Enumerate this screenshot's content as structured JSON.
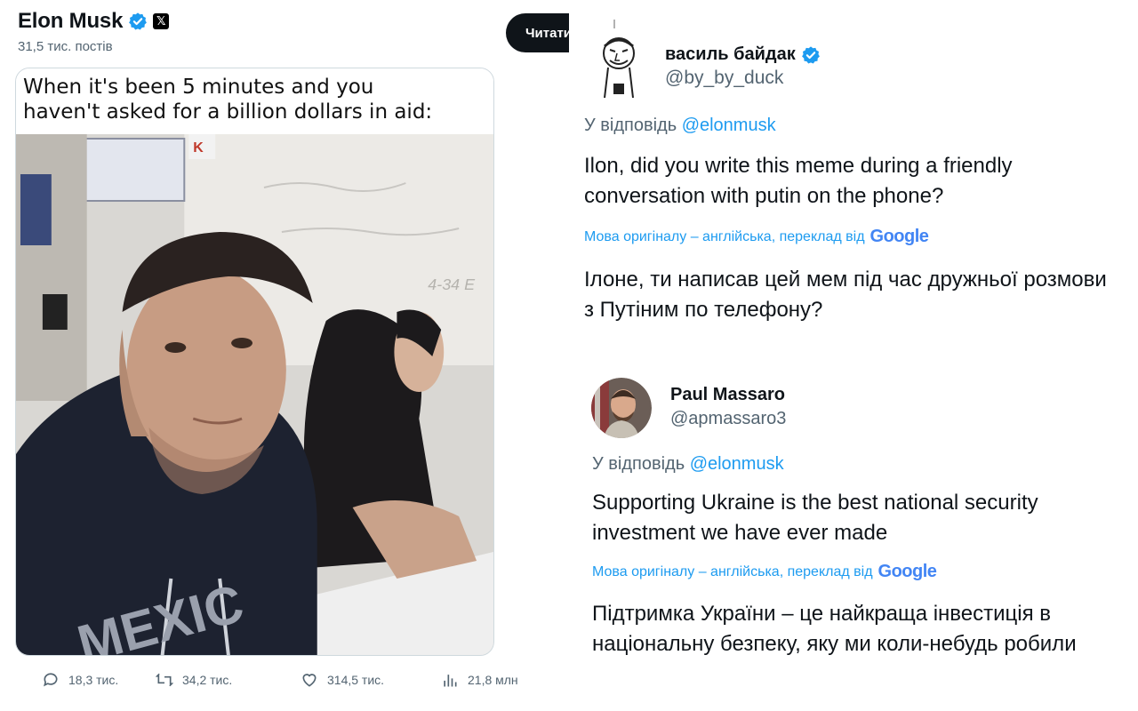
{
  "left_post": {
    "author_name": "Elon Musk",
    "posts_count": "31,5 тис. постів",
    "follow_label": "Читати",
    "meme_caption_line1": "When it's been 5 minutes and you",
    "meme_caption_line2": "haven't asked for a billion dollars in aid:",
    "stats": {
      "replies": "18,3 тис.",
      "reposts": "34,2 тис.",
      "likes": "314,5 тис.",
      "views": "21,8 млн"
    }
  },
  "reply1": {
    "author_name": "василь байдак",
    "handle": "@by_by_duck",
    "reply_prefix": "У відповідь",
    "reply_to": "@elonmusk",
    "text_line1": "Ilon, did you write this meme during a friendly",
    "text_line2": "conversation with putin on the phone?",
    "translation_note": "Мова оригіналу – англійська, переклад від",
    "translation_provider": "Google",
    "translation_line1": "Ілоне, ти написав цей мем під час дружньої розмови",
    "translation_line2": "з Путіним по телефону?"
  },
  "reply2": {
    "author_name": "Paul Massaro",
    "handle": "@apmassaro3",
    "reply_prefix": "У відповідь",
    "reply_to": "@elonmusk",
    "text_line1": "Supporting Ukraine is the best national security",
    "text_line2": "investment we have ever made",
    "translation_note": "Мова оригіналу – англійська, переклад від",
    "translation_provider": "Google",
    "translation_line1": "Підтримка України – це найкраща інвестиція в",
    "translation_line2": "національну безпеку, яку ми коли-небудь робили"
  },
  "colors": {
    "accent": "#1d9bf0",
    "text": "#0f1419",
    "secondary": "#536471"
  }
}
